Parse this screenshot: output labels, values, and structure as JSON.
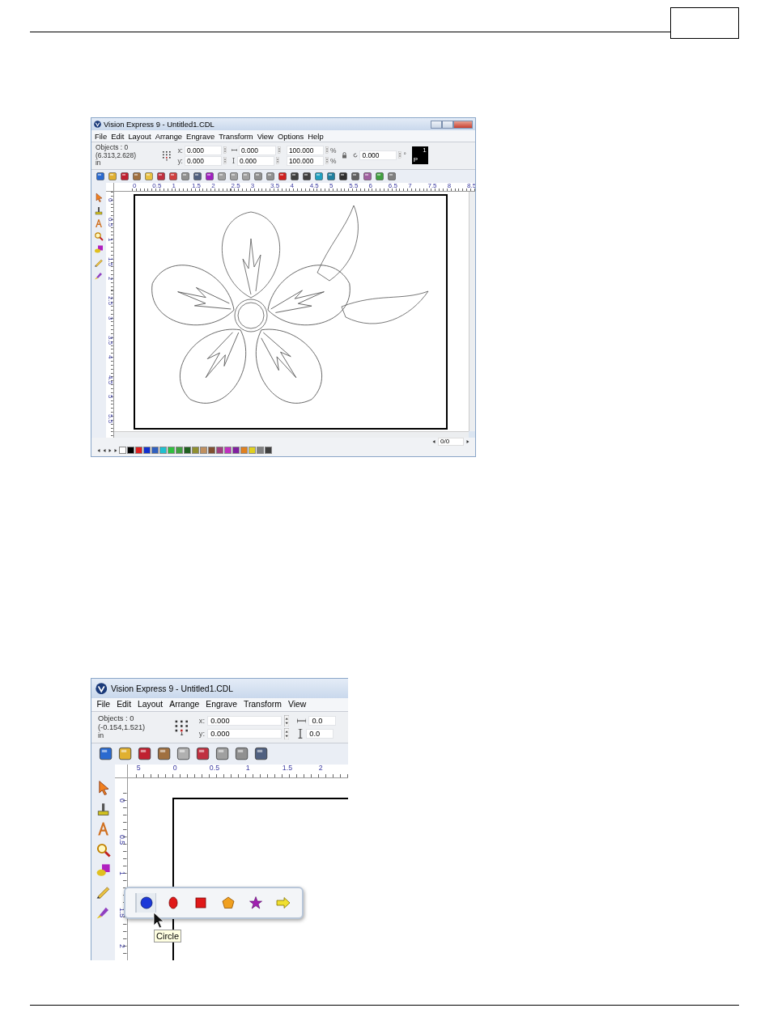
{
  "screenshots": [
    {
      "kind": "full",
      "title": "Vision Express 9 - Untitled1.CDL",
      "menu": [
        "File",
        "Edit",
        "Layout",
        "Arrange",
        "Engrave",
        "Transform",
        "View",
        "Options",
        "Help"
      ],
      "property_bar": {
        "objects": "Objects : 0",
        "position": "(6.313,2.628)",
        "unit": "in",
        "fields": [
          {
            "kind": "x",
            "label": "x:",
            "value": "0.000"
          },
          {
            "kind": "y",
            "label": "y:",
            "value": "0.000"
          },
          {
            "kind": "width",
            "value": "0.000"
          },
          {
            "kind": "height",
            "value": "0.000"
          },
          {
            "kind": "scale",
            "value": "100.000",
            "suffix": "%"
          },
          {
            "kind": "scale",
            "value": "100.000",
            "suffix": "%"
          },
          {
            "kind": "angle",
            "value": "0.000",
            "suffix": "°"
          }
        ],
        "preview_marks": [
          "1",
          "P"
        ]
      },
      "h_ruler": [
        "0",
        "0.5",
        "1",
        "1.5",
        "2",
        "2.5",
        "3",
        "3.5",
        "4",
        "4.5",
        "5",
        "5.5",
        "6",
        "6.5",
        "7",
        "7.5",
        "8",
        "8.5"
      ],
      "v_ruler": [
        "0",
        "0.5",
        "1",
        "1.5",
        "2",
        "2.5",
        "3",
        "3.5",
        "4",
        "4.5",
        "5",
        "5.5"
      ],
      "page_counter": "0/0",
      "palette": [
        {
          "color": "#ffffff"
        },
        {
          "color": "#000000"
        },
        {
          "color": "#e02020"
        },
        {
          "color": "#1030d0"
        },
        {
          "color": "#3060c0"
        },
        {
          "color": "#20c0d0"
        },
        {
          "color": "#30c040"
        },
        {
          "color": "#40a040"
        },
        {
          "color": "#206020"
        },
        {
          "color": "#909030"
        },
        {
          "color": "#c09060"
        },
        {
          "color": "#805030"
        },
        {
          "color": "#a04080"
        },
        {
          "color": "#c030c0"
        },
        {
          "color": "#8020a0"
        },
        {
          "color": "#e08020"
        },
        {
          "color": "#e0d020"
        },
        {
          "color": "#808080"
        },
        {
          "color": "#404040"
        }
      ]
    },
    {
      "kind": "zoomed",
      "title": "Vision Express 9 - Untitled1.CDL",
      "menu": [
        "File",
        "Edit",
        "Layout",
        "Arrange",
        "Engrave",
        "Transform",
        "View"
      ],
      "property_bar": {
        "objects": "Objects : 0",
        "position": "(-0.154,1.521)",
        "unit": "in",
        "fields": [
          {
            "kind": "x",
            "label": "x:",
            "value": "0.000"
          },
          {
            "kind": "y",
            "label": "y:",
            "value": "0.000"
          },
          {
            "kind": "width",
            "value": "0.0"
          },
          {
            "kind": "height",
            "value": "0.0"
          }
        ]
      },
      "h_ruler": [
        "5",
        "0",
        "0.5",
        "1",
        "1.5",
        "2"
      ],
      "v_ruler": [
        "0",
        "0.5",
        "1",
        "1.5",
        "2"
      ],
      "flyout": [
        {
          "kind": "circle",
          "selected": true
        },
        {
          "kind": "ellipse",
          "selected": false
        },
        {
          "kind": "square",
          "selected": false
        },
        {
          "kind": "pentagon",
          "selected": false
        },
        {
          "kind": "star",
          "selected": false
        },
        {
          "kind": "arrow",
          "selected": false
        }
      ],
      "tooltip": "Circle"
    }
  ]
}
